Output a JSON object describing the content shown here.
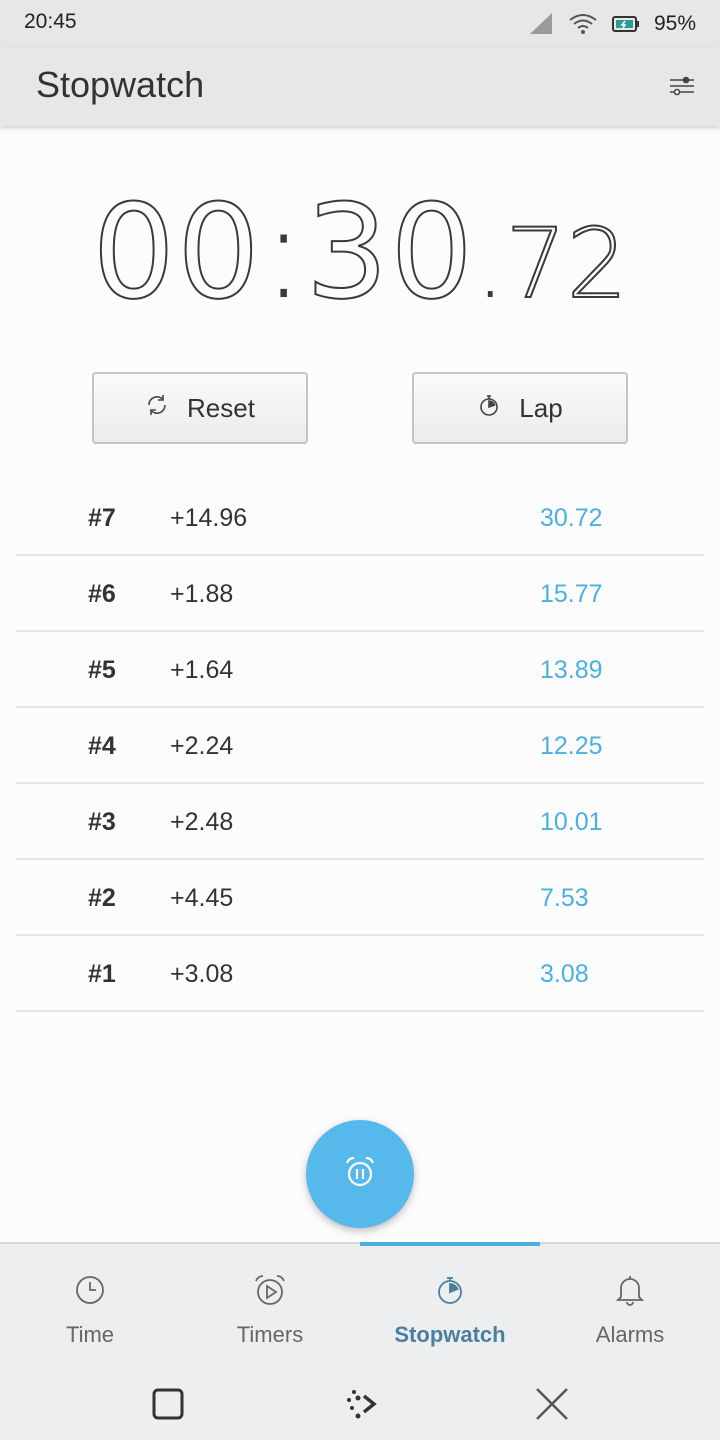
{
  "status_bar": {
    "time": "20:45",
    "battery": "95%"
  },
  "header": {
    "title": "Stopwatch"
  },
  "timer": {
    "minutes": "00",
    "sep": ":",
    "seconds": "30",
    "dot": ".",
    "fraction": "72"
  },
  "buttons": {
    "reset": "Reset",
    "lap": "Lap"
  },
  "laps": [
    {
      "num": "#7",
      "split": "+14.96",
      "total": "30.72"
    },
    {
      "num": "#6",
      "split": "+1.88",
      "total": "15.77"
    },
    {
      "num": "#5",
      "split": "+1.64",
      "total": "13.89"
    },
    {
      "num": "#4",
      "split": "+2.24",
      "total": "12.25"
    },
    {
      "num": "#3",
      "split": "+2.48",
      "total": "10.01"
    },
    {
      "num": "#2",
      "split": "+4.45",
      "total": "7.53"
    },
    {
      "num": "#1",
      "split": "+3.08",
      "total": "3.08"
    }
  ],
  "tabs": [
    {
      "label": "Time",
      "icon": "clock-icon"
    },
    {
      "label": "Timers",
      "icon": "timer-play-icon"
    },
    {
      "label": "Stopwatch",
      "icon": "stopwatch-icon",
      "active": true
    },
    {
      "label": "Alarms",
      "icon": "bell-icon"
    }
  ],
  "colors": {
    "accent": "#4ab0e2",
    "fab": "#57b8ec",
    "active_tab_text": "#4a7f9e"
  }
}
